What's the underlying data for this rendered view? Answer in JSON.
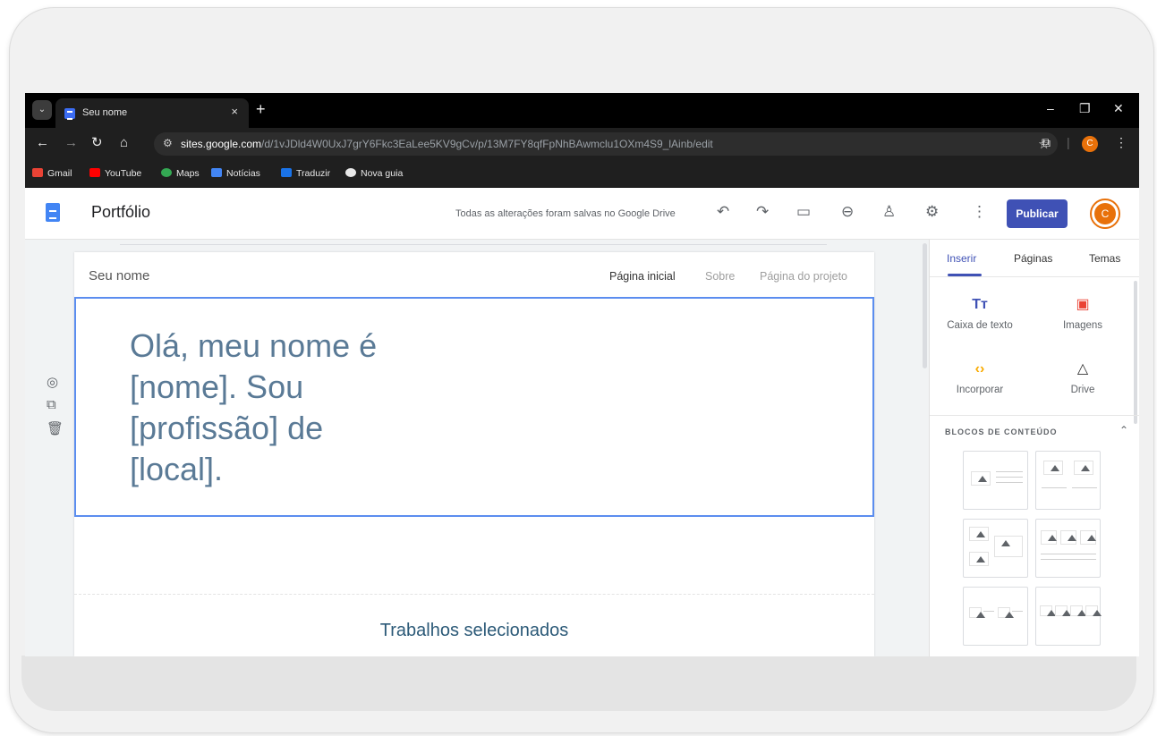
{
  "browser": {
    "tab_title": "Seu nome",
    "tab_close": "×",
    "new_tab": "+",
    "window_controls": {
      "minimize": "–",
      "restore": "❐",
      "close": "✕"
    },
    "url_host": "sites.google.com",
    "url_path": "/d/1vJDld4W0UxJ7grY6Fkc3EaLee5KV9gCv/p/13M7FY8qfFpNhBAwmclu1OXm4S9_lAinb/edit",
    "profile_initial": "C",
    "bookmarks": [
      "Gmail",
      "YouTube",
      "Maps",
      "Notícias",
      "Traduzir",
      "Nova guia"
    ]
  },
  "sites_toolbar": {
    "site_title": "Portfólio",
    "save_status": "Todas as alterações foram salvas no Google Drive",
    "publish_label": "Publicar",
    "avatar_initial": "C"
  },
  "page": {
    "site_name": "Seu nome",
    "nav": [
      "Página inicial",
      "Sobre",
      "Página do projeto"
    ],
    "hero_lines": [
      "Olá, meu nome é",
      "[nome]. Sou",
      "[profissão] de",
      "[local]."
    ],
    "section_title": "Trabalhos selecionados"
  },
  "panel": {
    "tabs": [
      "Inserir",
      "Páginas",
      "Temas"
    ],
    "insert_items": [
      {
        "icon": "text-box-icon",
        "glyph": "Tт",
        "label": "Caixa de texto"
      },
      {
        "icon": "image-icon",
        "glyph": "▣",
        "label": "Imagens"
      },
      {
        "icon": "embed-icon",
        "glyph": "‹›",
        "label": "Incorporar"
      },
      {
        "icon": "drive-icon",
        "glyph": "△",
        "label": "Drive"
      }
    ],
    "content_blocks_title": "BLOCOS DE CONTEÚDO"
  },
  "colors": {
    "accent": "#3f51b5",
    "avatar": "#e8710a",
    "hero_text": "#5a7a96",
    "selection_border": "#5b8def"
  }
}
